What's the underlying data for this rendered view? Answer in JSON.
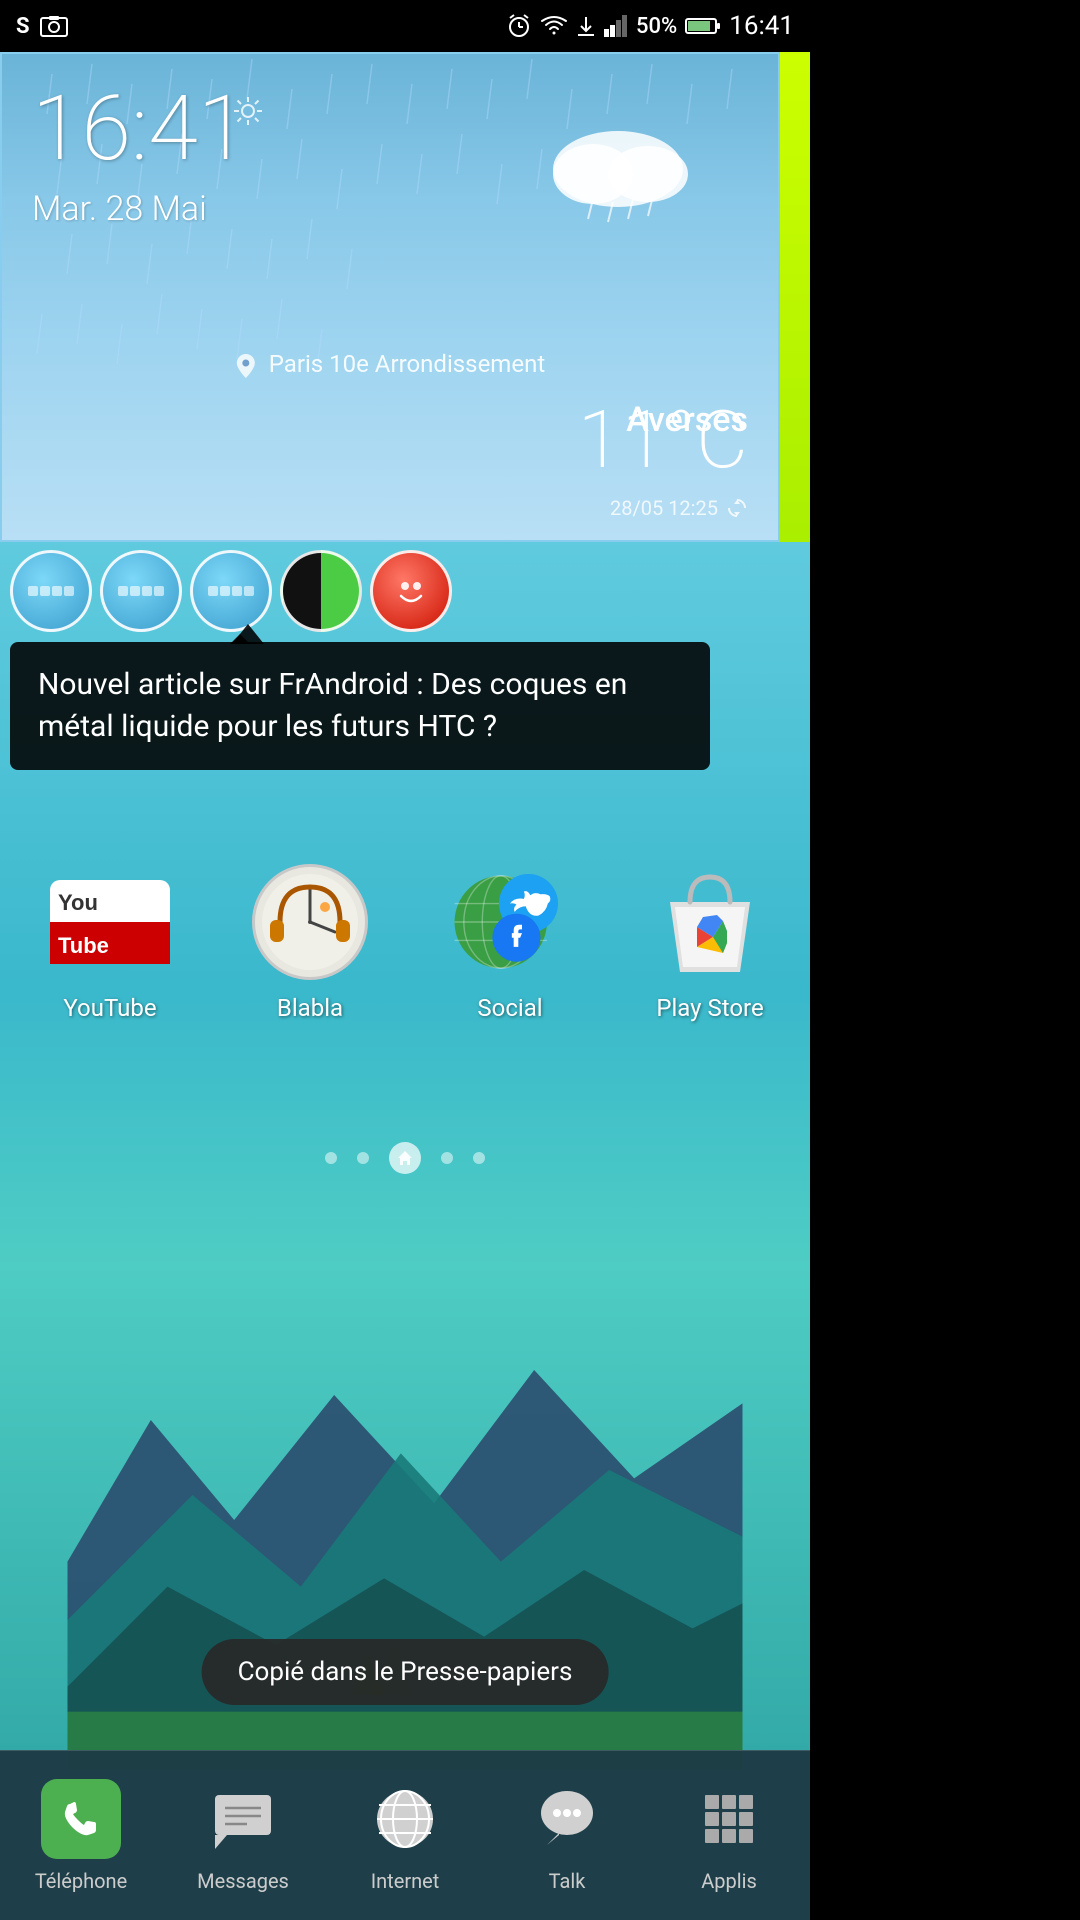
{
  "statusBar": {
    "time": "16:41",
    "battery": "50%",
    "signal": "50%"
  },
  "weather": {
    "time": "16:41",
    "date": "Mar. 28 Mai",
    "location": "Paris 10e  Arrondissement",
    "condition": "Averses",
    "temperature": "11°C",
    "updated": "28/05 12:25"
  },
  "tooltip": {
    "text": "Nouvel article sur FrAndroid : Des coques en métal liquide pour les futurs HTC ?"
  },
  "apps": [
    {
      "name": "YouTube",
      "type": "youtube"
    },
    {
      "name": "Blabla",
      "type": "blabla"
    },
    {
      "name": "Social",
      "type": "social"
    },
    {
      "name": "Play Store",
      "type": "playstore"
    }
  ],
  "dockApps": [
    {
      "name": "dock1",
      "type": "blue"
    },
    {
      "name": "dock2",
      "type": "blue"
    },
    {
      "name": "dock3",
      "type": "blue"
    },
    {
      "name": "dock4",
      "type": "green"
    },
    {
      "name": "dock5",
      "type": "red"
    }
  ],
  "clipboard": {
    "text": "Copié dans le Presse-papiers"
  },
  "navBar": {
    "items": [
      {
        "label": "Téléphone",
        "type": "phone"
      },
      {
        "label": "Messages",
        "type": "messages"
      },
      {
        "label": "Internet",
        "type": "internet"
      },
      {
        "label": "Talk",
        "type": "talk"
      },
      {
        "label": "Applis",
        "type": "apps"
      }
    ]
  },
  "pageDots": {
    "count": 5,
    "homeIndex": 2
  }
}
